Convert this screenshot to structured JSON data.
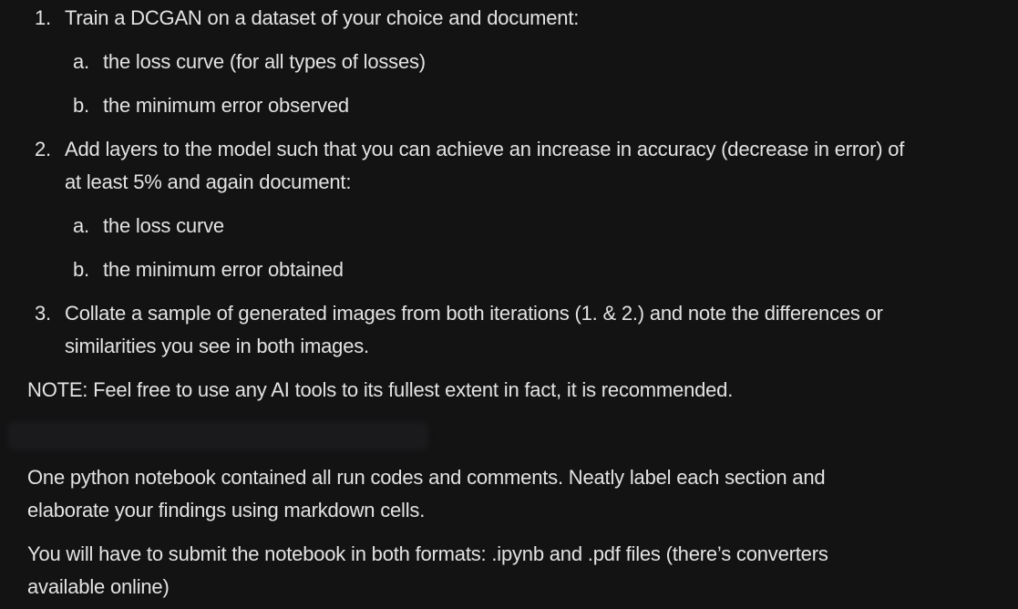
{
  "list": [
    {
      "marker": "1.",
      "text": "Train a DCGAN on a dataset of your choice and document:",
      "subitems": [
        {
          "marker": "a.",
          "text": "the loss curve (for all types of losses)"
        },
        {
          "marker": "b.",
          "text": "the minimum error observed"
        }
      ]
    },
    {
      "marker": "2.",
      "text_line1": "Add layers to the model such that you can achieve an increase in accuracy (decrease in error) of",
      "text_line2": "at least 5% and again document:",
      "subitems": [
        {
          "marker": "a.",
          "text": "the loss curve"
        },
        {
          "marker": "b.",
          "text": "the minimum error obtained"
        }
      ]
    },
    {
      "marker": "3.",
      "text_line1": "Collate a sample of generated images from both iterations (1. & 2.) and note the differences or",
      "text_line2": "similarities you see in both images."
    }
  ],
  "note": "NOTE: Feel free to use any AI tools to its fullest extent in fact, it is recommended.",
  "paragraphs": [
    {
      "line1": "One python notebook contained all run codes and comments. Neatly label each section and",
      "line2": "elaborate your findings using markdown cells."
    },
    {
      "line1": "You will have to submit the notebook in both formats: .ipynb and .pdf files (there’s converters",
      "line2": "available online)"
    }
  ]
}
